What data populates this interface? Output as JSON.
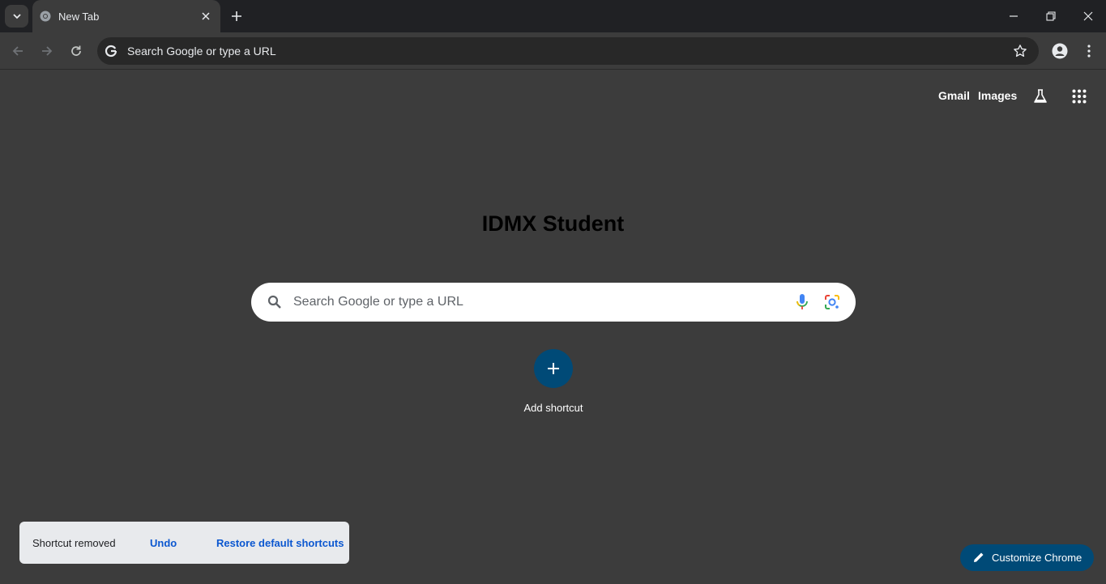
{
  "tab": {
    "title": "New Tab"
  },
  "omnibox": {
    "placeholder": "Search Google or type a URL"
  },
  "header_links": {
    "gmail": "Gmail",
    "images": "Images"
  },
  "logo": {
    "text": "IDMX Student"
  },
  "search": {
    "placeholder": "Search Google or type a URL"
  },
  "shortcuts": {
    "add_label": "Add shortcut"
  },
  "toast": {
    "message": "Shortcut removed",
    "undo": "Undo",
    "restore": "Restore default shortcuts"
  },
  "customize": {
    "label": "Customize Chrome"
  },
  "icons": {
    "tab_search": "chevron-down-icon",
    "favicon": "chrome-icon",
    "close": "close-icon",
    "new_tab": "plus-icon",
    "back": "arrow-left-icon",
    "forward": "arrow-right-icon",
    "reload": "reload-icon",
    "google": "google-g-icon",
    "bookmark": "star-icon",
    "profile": "profile-icon",
    "menu": "kebab-menu-icon",
    "labs": "flask-icon",
    "apps": "apps-grid-icon",
    "search": "search-icon",
    "mic": "mic-icon",
    "lens": "lens-icon",
    "add": "plus-icon",
    "edit": "pencil-icon"
  },
  "colors": {
    "titlebar": "#202124",
    "surface": "#3c3c3c",
    "accent": "#004a77",
    "link": "#0b57d0"
  }
}
